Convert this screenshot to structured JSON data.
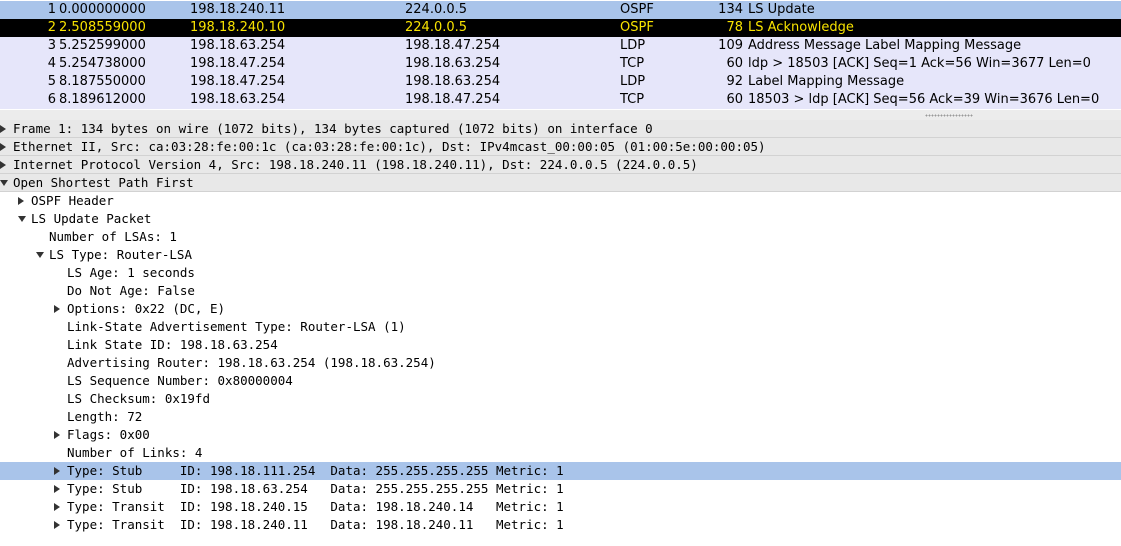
{
  "packets": [
    {
      "no": "1",
      "time": "0.000000000",
      "src": "198.18.240.11",
      "dst": "224.0.0.5",
      "proto": "OSPF",
      "len": "134",
      "info": "LS Update",
      "style": "ospf"
    },
    {
      "no": "2",
      "time": "2.508559000",
      "src": "198.18.240.10",
      "dst": "224.0.0.5",
      "proto": "OSPF",
      "len": "78",
      "info": "LS Acknowledge",
      "style": "ospf-sel"
    },
    {
      "no": "3",
      "time": "5.252599000",
      "src": "198.18.63.254",
      "dst": "198.18.47.254",
      "proto": "LDP",
      "len": "109",
      "info": "Address Message Label Mapping Message",
      "style": "ldp"
    },
    {
      "no": "4",
      "time": "5.254738000",
      "src": "198.18.47.254",
      "dst": "198.18.63.254",
      "proto": "TCP",
      "len": "60",
      "info": "ldp > 18503 [ACK] Seq=1 Ack=56 Win=3677 Len=0",
      "style": "tcp"
    },
    {
      "no": "5",
      "time": "8.187550000",
      "src": "198.18.47.254",
      "dst": "198.18.63.254",
      "proto": "LDP",
      "len": "92",
      "info": "Label Mapping Message",
      "style": "ldp"
    },
    {
      "no": "6",
      "time": "8.189612000",
      "src": "198.18.63.254",
      "dst": "198.18.47.254",
      "proto": "TCP",
      "len": "60",
      "info": "18503 > ldp [ACK] Seq=56 Ack=39 Win=3676 Len=0",
      "style": "tcp"
    }
  ],
  "details": [
    {
      "text": "Frame 1: 134 bytes on wire (1072 bits), 134 bytes captured (1072 bits) on interface 0",
      "level": 0,
      "twisty": "right",
      "kind": "top"
    },
    {
      "text": "Ethernet II, Src: ca:03:28:fe:00:1c (ca:03:28:fe:00:1c), Dst: IPv4mcast_00:00:05 (01:00:5e:00:00:05)",
      "level": 0,
      "twisty": "right",
      "kind": "top"
    },
    {
      "text": "Internet Protocol Version 4, Src: 198.18.240.11 (198.18.240.11), Dst: 224.0.0.5 (224.0.0.5)",
      "level": 0,
      "twisty": "right",
      "kind": "top"
    },
    {
      "text": "Open Shortest Path First",
      "level": 0,
      "twisty": "down",
      "kind": "top"
    },
    {
      "text": "OSPF Header",
      "level": 1,
      "twisty": "right",
      "kind": ""
    },
    {
      "text": "LS Update Packet",
      "level": 1,
      "twisty": "down",
      "kind": ""
    },
    {
      "text": "Number of LSAs: 1",
      "level": 2,
      "twisty": "",
      "kind": ""
    },
    {
      "text": "LS Type: Router-LSA",
      "level": 2,
      "twisty": "down",
      "kind": ""
    },
    {
      "text": "LS Age: 1 seconds",
      "level": 3,
      "twisty": "",
      "kind": ""
    },
    {
      "text": "Do Not Age: False",
      "level": 3,
      "twisty": "",
      "kind": ""
    },
    {
      "text": "Options: 0x22 (DC, E)",
      "level": 3,
      "twisty": "right",
      "kind": ""
    },
    {
      "text": "Link-State Advertisement Type: Router-LSA (1)",
      "level": 3,
      "twisty": "",
      "kind": ""
    },
    {
      "text": "Link State ID: 198.18.63.254",
      "level": 3,
      "twisty": "",
      "kind": ""
    },
    {
      "text": "Advertising Router: 198.18.63.254 (198.18.63.254)",
      "level": 3,
      "twisty": "",
      "kind": ""
    },
    {
      "text": "LS Sequence Number: 0x80000004",
      "level": 3,
      "twisty": "",
      "kind": ""
    },
    {
      "text": "LS Checksum: 0x19fd",
      "level": 3,
      "twisty": "",
      "kind": ""
    },
    {
      "text": "Length: 72",
      "level": 3,
      "twisty": "",
      "kind": ""
    },
    {
      "text": "Flags: 0x00",
      "level": 3,
      "twisty": "right",
      "kind": ""
    },
    {
      "text": "Number of Links: 4",
      "level": 3,
      "twisty": "",
      "kind": ""
    },
    {
      "text": "Type: Stub     ID: 198.18.111.254  Data: 255.255.255.255 Metric: 1",
      "level": 3,
      "twisty": "right",
      "kind": "sel"
    },
    {
      "text": "Type: Stub     ID: 198.18.63.254   Data: 255.255.255.255 Metric: 1",
      "level": 3,
      "twisty": "right",
      "kind": ""
    },
    {
      "text": "Type: Transit  ID: 198.18.240.15   Data: 198.18.240.14   Metric: 1",
      "level": 3,
      "twisty": "right",
      "kind": ""
    },
    {
      "text": "Type: Transit  ID: 198.18.240.11   Data: 198.18.240.11   Metric: 1",
      "level": 3,
      "twisty": "right",
      "kind": ""
    }
  ]
}
